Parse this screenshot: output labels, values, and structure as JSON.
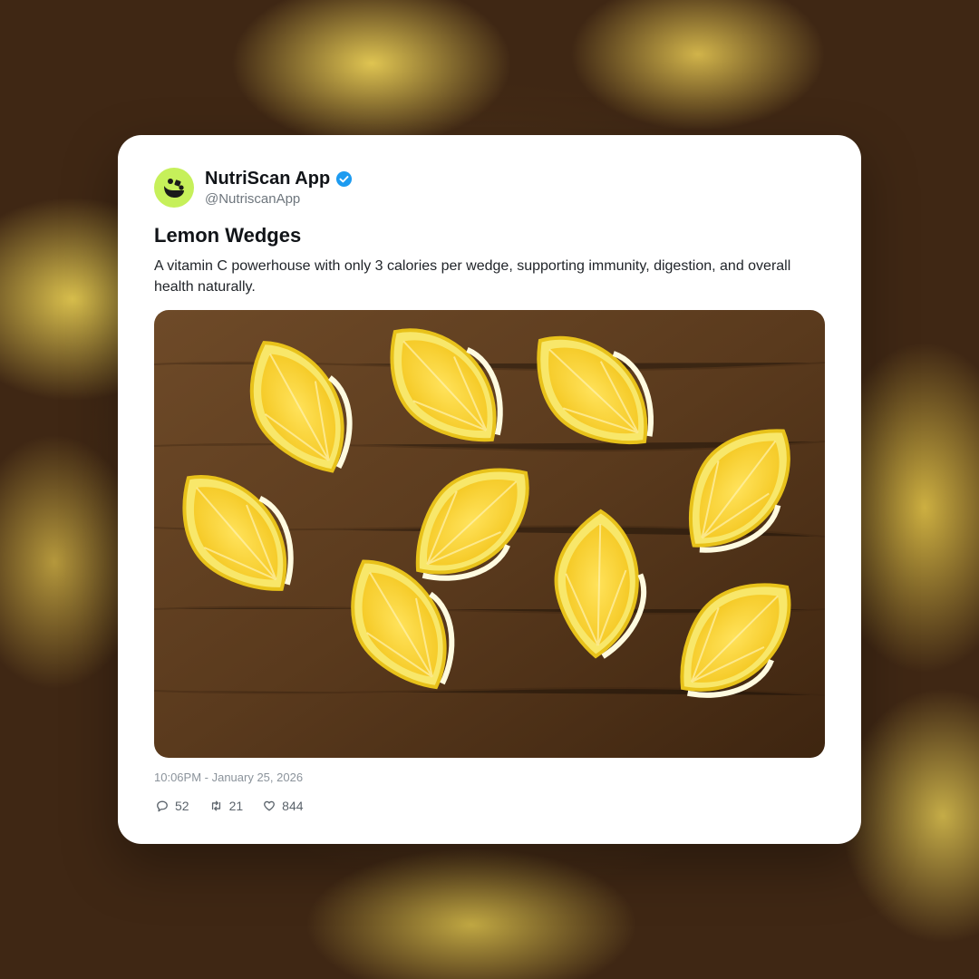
{
  "post": {
    "account_name": "NutriScan App",
    "handle": "@NutriscanApp",
    "verified": true,
    "title": "Lemon Wedges",
    "description": "A vitamin C powerhouse with only 3 calories per wedge, supporting immunity, digestion, and overall health naturally.",
    "image": {
      "subject": "lemon wedges on wooden board",
      "icon": "photo"
    },
    "timestamp": "10:06PM - January 25, 2026",
    "stats": {
      "replies": "52",
      "retweets": "21",
      "likes": "844"
    }
  },
  "colors": {
    "avatar_bg": "#c6f05a",
    "verified_badge": "#1d9bf0",
    "card_bg": "#ffffff"
  },
  "icons": [
    "brand-logo-icon",
    "verified-badge-icon",
    "reply-icon",
    "retweet-icon",
    "like-icon"
  ]
}
